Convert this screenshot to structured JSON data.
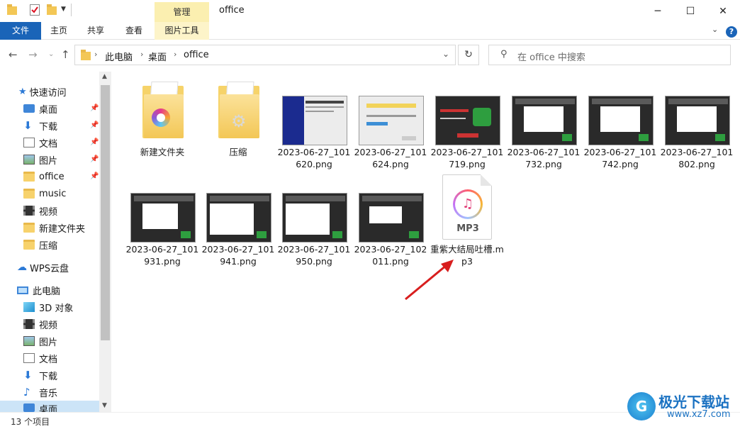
{
  "window": {
    "title": "office",
    "contextual_tab": "管理"
  },
  "ribbon": {
    "tabs": [
      {
        "label": "文件",
        "kind": "file"
      },
      {
        "label": "主页",
        "kind": "normal"
      },
      {
        "label": "共享",
        "kind": "normal"
      },
      {
        "label": "查看",
        "kind": "normal"
      },
      {
        "label": "图片工具",
        "kind": "tools"
      }
    ],
    "help": "?"
  },
  "address": {
    "crumbs": [
      "此电脑",
      "桌面",
      "office"
    ]
  },
  "search": {
    "placeholder": "在 office 中搜索"
  },
  "nav": {
    "quick_access": "快速访问",
    "items": [
      {
        "label": "桌面",
        "icon": "desktop-icon",
        "pinned": true
      },
      {
        "label": "下载",
        "icon": "download-icon",
        "pinned": true
      },
      {
        "label": "文档",
        "icon": "document-icon",
        "pinned": true
      },
      {
        "label": "图片",
        "icon": "pictures-icon",
        "pinned": true
      },
      {
        "label": "office",
        "icon": "folder-icon",
        "pinned": true
      },
      {
        "label": "music",
        "icon": "folder-icon",
        "pinned": false
      },
      {
        "label": "视频",
        "icon": "video-icon",
        "pinned": false
      },
      {
        "label": "新建文件夹",
        "icon": "folder-icon",
        "pinned": false
      },
      {
        "label": "压缩",
        "icon": "folder-icon",
        "pinned": false
      }
    ],
    "wps": "WPS云盘",
    "this_pc": "此电脑",
    "pc_items": [
      {
        "label": "3D 对象",
        "icon": "3d-objects-icon"
      },
      {
        "label": "视频",
        "icon": "video-icon"
      },
      {
        "label": "图片",
        "icon": "pictures-icon"
      },
      {
        "label": "文档",
        "icon": "document-icon"
      },
      {
        "label": "下载",
        "icon": "download-icon"
      },
      {
        "label": "音乐",
        "icon": "music-icon"
      },
      {
        "label": "桌面",
        "icon": "desktop-icon"
      }
    ]
  },
  "files": [
    {
      "name": "新建文件夹",
      "type": "folder-app"
    },
    {
      "name": "压缩",
      "type": "folder"
    },
    {
      "name": "2023-06-27_101620.png",
      "type": "image-dark-dialog"
    },
    {
      "name": "2023-06-27_101624.png",
      "type": "image-light-dialog"
    },
    {
      "name": "2023-06-27_101719.png",
      "type": "image-app"
    },
    {
      "name": "2023-06-27_101732.png",
      "type": "image-app-window"
    },
    {
      "name": "2023-06-27_101742.png",
      "type": "image-app-window"
    },
    {
      "name": "2023-06-27_101802.png",
      "type": "image-app-window"
    },
    {
      "name": "2023-06-27_101931.png",
      "type": "image-app-window"
    },
    {
      "name": "2023-06-27_101941.png",
      "type": "image-app-window"
    },
    {
      "name": "2023-06-27_101950.png",
      "type": "image-app-window"
    },
    {
      "name": "2023-06-27_102011.png",
      "type": "image-app-window"
    },
    {
      "name": "重紫大结局吐槽.mp3",
      "type": "mp3"
    }
  ],
  "mp3_icon_text": "MP3",
  "status": {
    "count_text": "13 个项目"
  },
  "watermark": {
    "title": "极光下载站",
    "url": "www.xz7.com"
  }
}
